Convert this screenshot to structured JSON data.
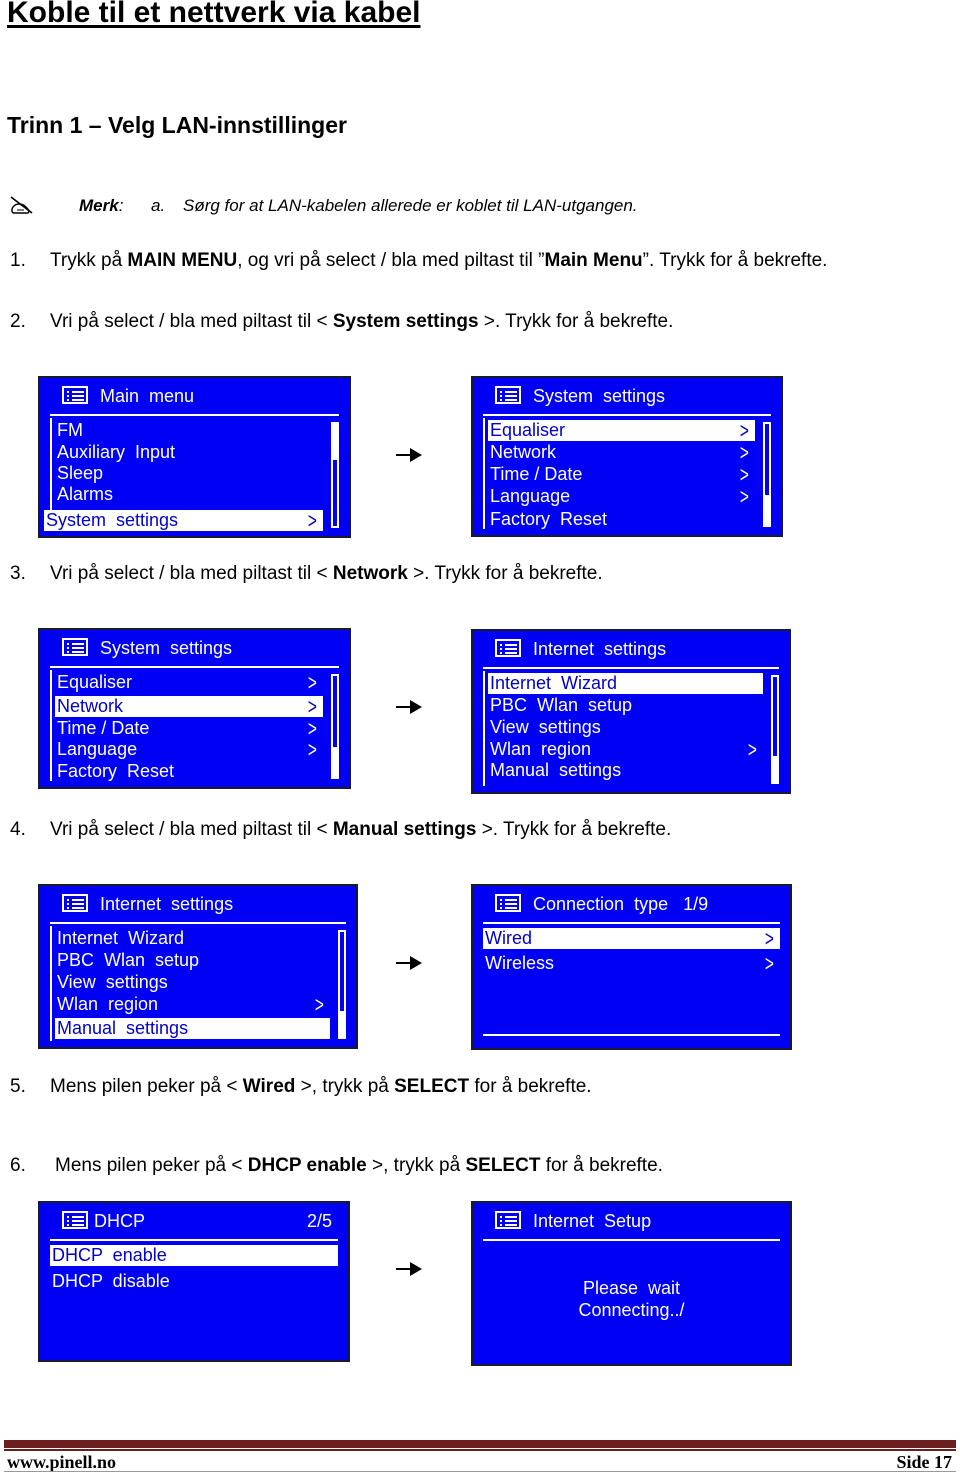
{
  "title": "Koble til et nettverk via kabel",
  "subtitle": "Trinn 1 – Velg LAN-innstillinger",
  "note": {
    "icon": "pencil-note-icon",
    "label": "Merk",
    "colon": ":",
    "letter": "a.",
    "text": "Sørg for at LAN-kabelen allerede er koblet til LAN-utgangen."
  },
  "steps": [
    {
      "num": "1.",
      "parts": [
        "Trykk på ",
        "MAIN MENU",
        ", og vri på select / bla med piltast til ”",
        "Main Menu",
        "”. Trykk for å bekrefte."
      ]
    },
    {
      "num": "2.",
      "parts": [
        "Vri på select / bla med piltast til < ",
        "System settings",
        " >. Trykk for å bekrefte."
      ]
    },
    {
      "num": "3.",
      "parts": [
        "Vri på select / bla med piltast til < ",
        "Network",
        " >. Trykk for å bekrefte."
      ]
    },
    {
      "num": "4.",
      "parts": [
        "Vri på select / bla med piltast til < ",
        "Manual settings",
        " >. Trykk for å bekrefte."
      ]
    },
    {
      "num": "5.",
      "parts": [
        "Mens pilen peker på < ",
        "Wired",
        " >, trykk på ",
        "SELECT",
        " for å bekrefte."
      ]
    },
    {
      "num": "6.",
      "parts": [
        "Mens pilen peker på < ",
        "DHCP enable",
        " >, trykk på ",
        "SELECT",
        " for å bekrefte."
      ]
    }
  ],
  "screens": {
    "main_menu": {
      "title": "Main  menu",
      "items": [
        "FM",
        "Auxiliary  Input",
        "Sleep",
        "Alarms",
        "System  settings"
      ],
      "selected": 4
    },
    "system_settings_a": {
      "title": "System  settings",
      "items": [
        "Equaliser",
        "Network",
        "Time / Date",
        "Language",
        "Factory  Reset"
      ],
      "selected": 0
    },
    "system_settings_b": {
      "title": "System  settings",
      "items": [
        "Equaliser",
        "Network",
        "Time / Date",
        "Language",
        "Factory  Reset"
      ],
      "selected": 1
    },
    "internet_settings_a": {
      "title": "Internet  settings",
      "items": [
        "Internet  Wizard",
        "PBC  Wlan  setup",
        "View  settings",
        "Wlan  region",
        "Manual  settings"
      ],
      "selected": 0
    },
    "internet_settings_b": {
      "title": "Internet  settings",
      "items": [
        "Internet  Wizard",
        "PBC  Wlan  setup",
        "View  settings",
        "Wlan  region",
        "Manual  settings"
      ],
      "selected": 4
    },
    "connection_type": {
      "title": "Connection  type   1/9",
      "items": [
        "Wired",
        "Wireless"
      ],
      "selected": 0
    },
    "dhcp": {
      "title": "DHCP",
      "count": "2/5",
      "items": [
        "DHCP  enable",
        "DHCP  disable"
      ],
      "selected": 0
    },
    "internet_setup": {
      "title": "Internet  Setup",
      "message_line1": "Please  wait",
      "message_line2": "Connecting../"
    }
  },
  "chevron": ">",
  "colors": {
    "screen_bg": "#0000f4",
    "footer_rule": "#6b1f1f"
  },
  "footer": {
    "website": "www.pinell.no",
    "page": "Side 17"
  }
}
